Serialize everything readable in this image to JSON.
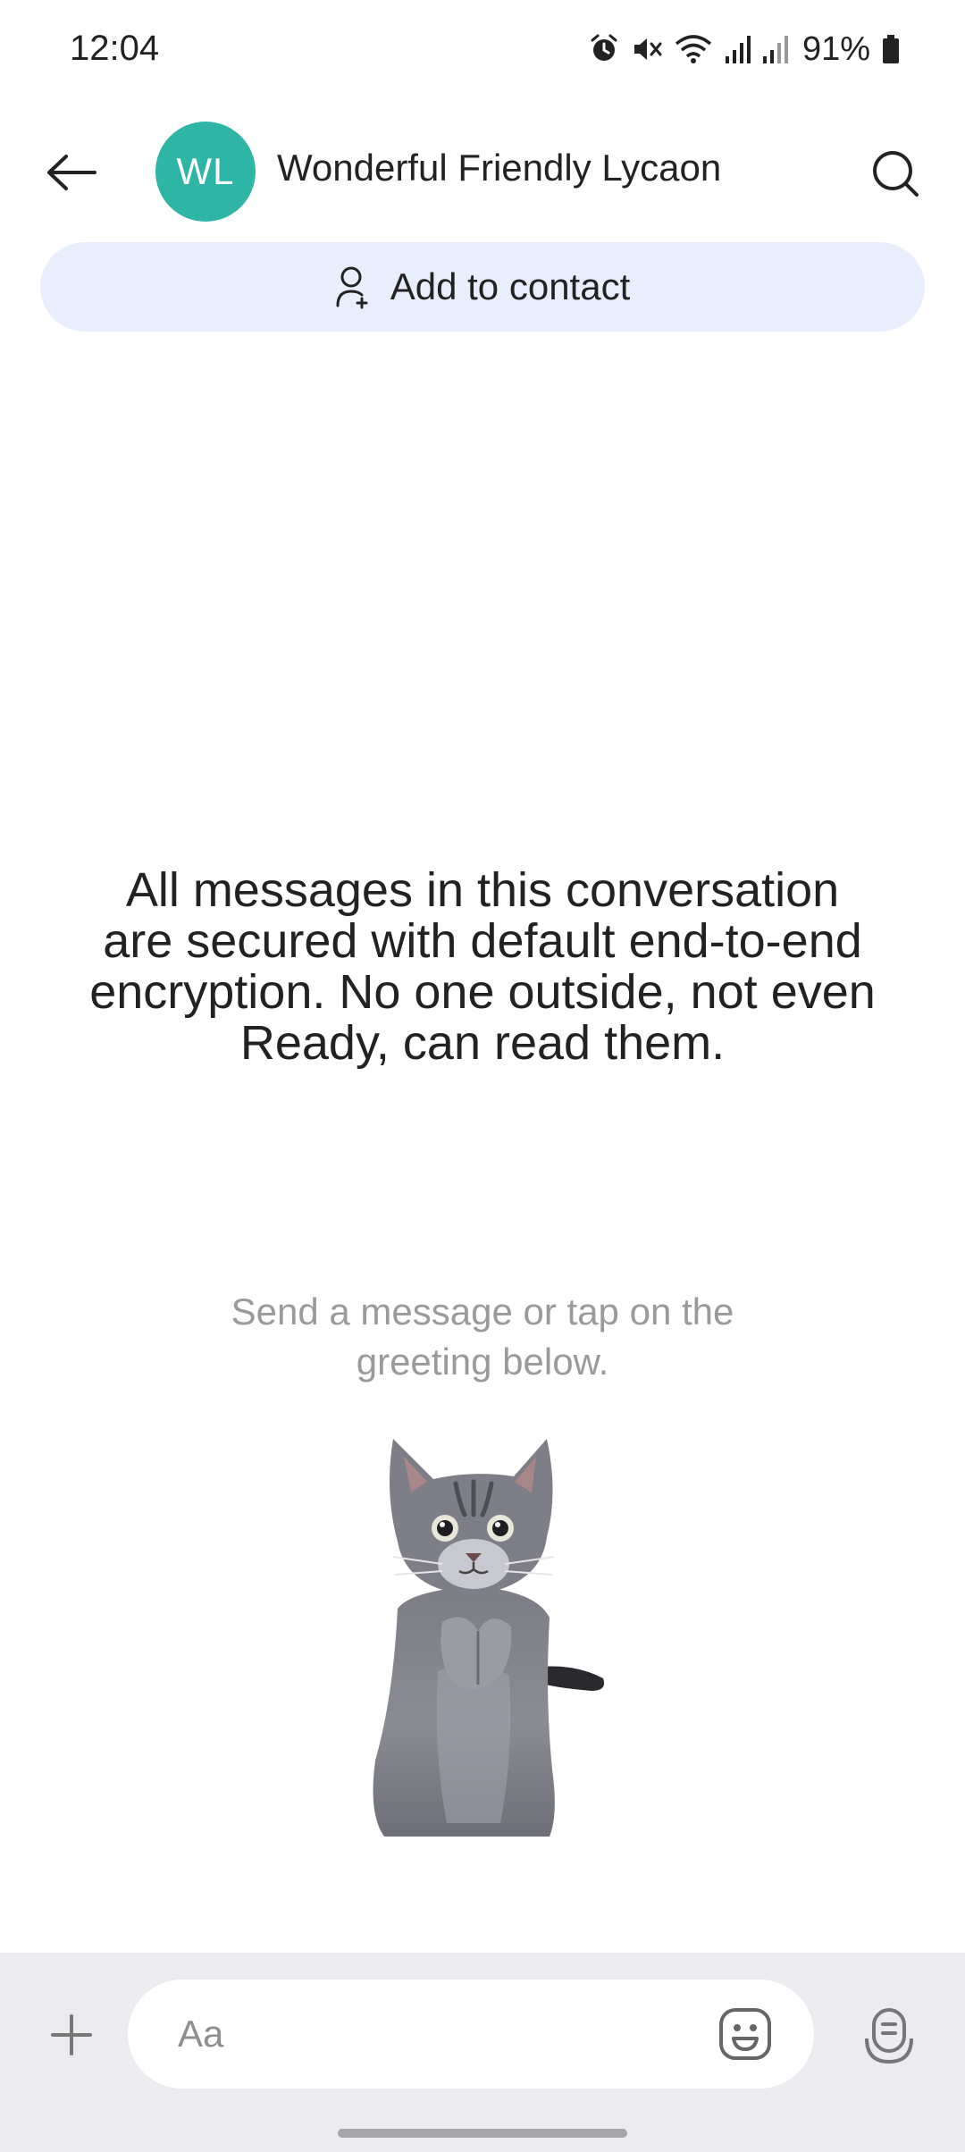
{
  "status_bar": {
    "time": "12:04",
    "battery": "91%",
    "icons": [
      "alarm-icon",
      "mute-icon",
      "wifi-icon",
      "signal-icon",
      "signal-icon",
      "battery-icon"
    ]
  },
  "header": {
    "avatar_initials": "WL",
    "avatar_color": "#2fb5a6",
    "contact_name": "Wonderful Friendly Lycaon",
    "back_icon": "arrow-left-icon",
    "search_icon": "search-icon"
  },
  "add_contact": {
    "label": "Add to contact",
    "icon": "add-person-icon",
    "bg_color": "#e8eefc"
  },
  "conversation": {
    "encryption_notice": "All messages in this conversation are secured with default end-to-end encryption. No one outside, not even Ready, can read them.",
    "greeting_hint": "Send a message or tap on the greeting below.",
    "sticker": "cat-sticker"
  },
  "composer": {
    "placeholder": "Aa",
    "plus_icon": "plus-icon",
    "emoji_icon": "emoji-icon",
    "voice_icon": "voice-message-icon"
  }
}
